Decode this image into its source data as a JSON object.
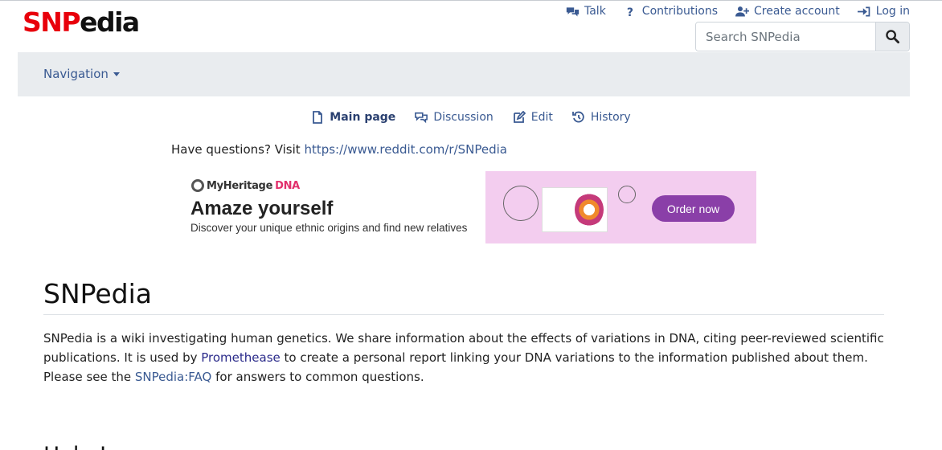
{
  "logo": {
    "part1": "SNP",
    "part2": "edia"
  },
  "personal_nav": [
    {
      "label": "Talk",
      "icon": "chat-bubbles-icon"
    },
    {
      "label": "Contributions",
      "icon": "question-mark-icon"
    },
    {
      "label": "Create account",
      "icon": "user-plus-icon"
    },
    {
      "label": "Log in",
      "icon": "sign-in-icon"
    }
  ],
  "search": {
    "placeholder": "Search SNPedia",
    "value": ""
  },
  "navbar": {
    "dropdown_label": "Navigation"
  },
  "page_tabs": [
    {
      "label": "Main page",
      "icon": "page-icon",
      "active": true
    },
    {
      "label": "Discussion",
      "icon": "chat-bubbles-icon",
      "active": false
    },
    {
      "label": "Edit",
      "icon": "edit-icon",
      "active": false
    },
    {
      "label": "History",
      "icon": "history-icon",
      "active": false
    }
  ],
  "notice": {
    "prefix": "Have questions? Visit ",
    "link": "https://www.reddit.com/r/SNPedia"
  },
  "ad": {
    "brand": "MyHeritage",
    "brand_suffix": "DNA",
    "headline": "Amaze yourself",
    "subline": "Discover your unique ethnic origins and find new relatives",
    "cta": "Order now",
    "accent_color": "#8a3fa8",
    "background_color": "#f3cdef"
  },
  "article": {
    "title": "SNPedia",
    "p1_before": "SNPedia is a wiki investigating human genetics. We share information about the effects of variations in DNA, citing peer-reviewed scientific publications. It is used by ",
    "promethease_link": "Promethease",
    "p1_middle": " to create a personal report linking your DNA variations to the information published about them. Please see the ",
    "faq_link": "SNPedia:FAQ",
    "p1_after": " for answers to common questions.",
    "next_heading": "Help Improve"
  },
  "colors": {
    "link": "#3a5a92",
    "logo_red": "#e8000b",
    "navbar_bg": "#e9ecef"
  }
}
